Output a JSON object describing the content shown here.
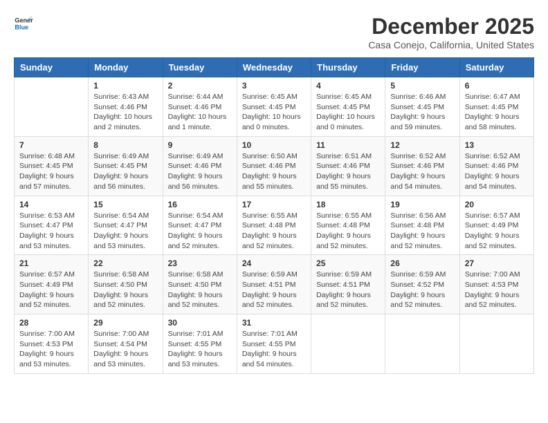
{
  "logo": {
    "general": "General",
    "blue": "Blue"
  },
  "title": "December 2025",
  "location": "Casa Conejo, California, United States",
  "weekdays": [
    "Sunday",
    "Monday",
    "Tuesday",
    "Wednesday",
    "Thursday",
    "Friday",
    "Saturday"
  ],
  "weeks": [
    [
      {
        "day": "",
        "sunrise": "",
        "sunset": "",
        "daylight": ""
      },
      {
        "day": "1",
        "sunrise": "Sunrise: 6:43 AM",
        "sunset": "Sunset: 4:46 PM",
        "daylight": "Daylight: 10 hours and 2 minutes."
      },
      {
        "day": "2",
        "sunrise": "Sunrise: 6:44 AM",
        "sunset": "Sunset: 4:46 PM",
        "daylight": "Daylight: 10 hours and 1 minute."
      },
      {
        "day": "3",
        "sunrise": "Sunrise: 6:45 AM",
        "sunset": "Sunset: 4:45 PM",
        "daylight": "Daylight: 10 hours and 0 minutes."
      },
      {
        "day": "4",
        "sunrise": "Sunrise: 6:45 AM",
        "sunset": "Sunset: 4:45 PM",
        "daylight": "Daylight: 10 hours and 0 minutes."
      },
      {
        "day": "5",
        "sunrise": "Sunrise: 6:46 AM",
        "sunset": "Sunset: 4:45 PM",
        "daylight": "Daylight: 9 hours and 59 minutes."
      },
      {
        "day": "6",
        "sunrise": "Sunrise: 6:47 AM",
        "sunset": "Sunset: 4:45 PM",
        "daylight": "Daylight: 9 hours and 58 minutes."
      }
    ],
    [
      {
        "day": "7",
        "sunrise": "Sunrise: 6:48 AM",
        "sunset": "Sunset: 4:45 PM",
        "daylight": "Daylight: 9 hours and 57 minutes."
      },
      {
        "day": "8",
        "sunrise": "Sunrise: 6:49 AM",
        "sunset": "Sunset: 4:45 PM",
        "daylight": "Daylight: 9 hours and 56 minutes."
      },
      {
        "day": "9",
        "sunrise": "Sunrise: 6:49 AM",
        "sunset": "Sunset: 4:46 PM",
        "daylight": "Daylight: 9 hours and 56 minutes."
      },
      {
        "day": "10",
        "sunrise": "Sunrise: 6:50 AM",
        "sunset": "Sunset: 4:46 PM",
        "daylight": "Daylight: 9 hours and 55 minutes."
      },
      {
        "day": "11",
        "sunrise": "Sunrise: 6:51 AM",
        "sunset": "Sunset: 4:46 PM",
        "daylight": "Daylight: 9 hours and 55 minutes."
      },
      {
        "day": "12",
        "sunrise": "Sunrise: 6:52 AM",
        "sunset": "Sunset: 4:46 PM",
        "daylight": "Daylight: 9 hours and 54 minutes."
      },
      {
        "day": "13",
        "sunrise": "Sunrise: 6:52 AM",
        "sunset": "Sunset: 4:46 PM",
        "daylight": "Daylight: 9 hours and 54 minutes."
      }
    ],
    [
      {
        "day": "14",
        "sunrise": "Sunrise: 6:53 AM",
        "sunset": "Sunset: 4:47 PM",
        "daylight": "Daylight: 9 hours and 53 minutes."
      },
      {
        "day": "15",
        "sunrise": "Sunrise: 6:54 AM",
        "sunset": "Sunset: 4:47 PM",
        "daylight": "Daylight: 9 hours and 53 minutes."
      },
      {
        "day": "16",
        "sunrise": "Sunrise: 6:54 AM",
        "sunset": "Sunset: 4:47 PM",
        "daylight": "Daylight: 9 hours and 52 minutes."
      },
      {
        "day": "17",
        "sunrise": "Sunrise: 6:55 AM",
        "sunset": "Sunset: 4:48 PM",
        "daylight": "Daylight: 9 hours and 52 minutes."
      },
      {
        "day": "18",
        "sunrise": "Sunrise: 6:55 AM",
        "sunset": "Sunset: 4:48 PM",
        "daylight": "Daylight: 9 hours and 52 minutes."
      },
      {
        "day": "19",
        "sunrise": "Sunrise: 6:56 AM",
        "sunset": "Sunset: 4:48 PM",
        "daylight": "Daylight: 9 hours and 52 minutes."
      },
      {
        "day": "20",
        "sunrise": "Sunrise: 6:57 AM",
        "sunset": "Sunset: 4:49 PM",
        "daylight": "Daylight: 9 hours and 52 minutes."
      }
    ],
    [
      {
        "day": "21",
        "sunrise": "Sunrise: 6:57 AM",
        "sunset": "Sunset: 4:49 PM",
        "daylight": "Daylight: 9 hours and 52 minutes."
      },
      {
        "day": "22",
        "sunrise": "Sunrise: 6:58 AM",
        "sunset": "Sunset: 4:50 PM",
        "daylight": "Daylight: 9 hours and 52 minutes."
      },
      {
        "day": "23",
        "sunrise": "Sunrise: 6:58 AM",
        "sunset": "Sunset: 4:50 PM",
        "daylight": "Daylight: 9 hours and 52 minutes."
      },
      {
        "day": "24",
        "sunrise": "Sunrise: 6:59 AM",
        "sunset": "Sunset: 4:51 PM",
        "daylight": "Daylight: 9 hours and 52 minutes."
      },
      {
        "day": "25",
        "sunrise": "Sunrise: 6:59 AM",
        "sunset": "Sunset: 4:51 PM",
        "daylight": "Daylight: 9 hours and 52 minutes."
      },
      {
        "day": "26",
        "sunrise": "Sunrise: 6:59 AM",
        "sunset": "Sunset: 4:52 PM",
        "daylight": "Daylight: 9 hours and 52 minutes."
      },
      {
        "day": "27",
        "sunrise": "Sunrise: 7:00 AM",
        "sunset": "Sunset: 4:53 PM",
        "daylight": "Daylight: 9 hours and 52 minutes."
      }
    ],
    [
      {
        "day": "28",
        "sunrise": "Sunrise: 7:00 AM",
        "sunset": "Sunset: 4:53 PM",
        "daylight": "Daylight: 9 hours and 53 minutes."
      },
      {
        "day": "29",
        "sunrise": "Sunrise: 7:00 AM",
        "sunset": "Sunset: 4:54 PM",
        "daylight": "Daylight: 9 hours and 53 minutes."
      },
      {
        "day": "30",
        "sunrise": "Sunrise: 7:01 AM",
        "sunset": "Sunset: 4:55 PM",
        "daylight": "Daylight: 9 hours and 53 minutes."
      },
      {
        "day": "31",
        "sunrise": "Sunrise: 7:01 AM",
        "sunset": "Sunset: 4:55 PM",
        "daylight": "Daylight: 9 hours and 54 minutes."
      },
      {
        "day": "",
        "sunrise": "",
        "sunset": "",
        "daylight": ""
      },
      {
        "day": "",
        "sunrise": "",
        "sunset": "",
        "daylight": ""
      },
      {
        "day": "",
        "sunrise": "",
        "sunset": "",
        "daylight": ""
      }
    ]
  ]
}
